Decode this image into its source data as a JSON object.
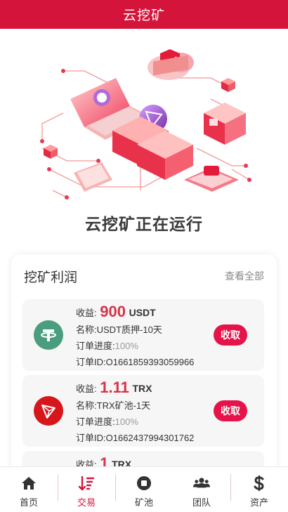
{
  "header": {
    "title": "云挖矿"
  },
  "hero": {
    "status_text": "云挖矿正在运行"
  },
  "profit": {
    "title": "挖矿利润",
    "view_all": "查看全部",
    "labels": {
      "earn": "收益:",
      "name": "名称:",
      "progress": "订单进度:",
      "order_id": "订单ID:",
      "collect": "收取"
    },
    "orders": [
      {
        "coin_icon": "usdt-icon",
        "amount": "900",
        "unit": "USDT",
        "name": "USDT质押-10天",
        "progress": "100%",
        "order_id": "O1661859393059966"
      },
      {
        "coin_icon": "trx-icon",
        "amount": "1.11",
        "unit": "TRX",
        "name": "TRX矿池-1天",
        "progress": "100%",
        "order_id": "O1662437994301762"
      },
      {
        "coin_icon": "trx-icon",
        "amount": "1",
        "unit": "TRX"
      }
    ]
  },
  "nav": {
    "items": [
      {
        "label": "首页",
        "icon": "home-icon"
      },
      {
        "label": "交易",
        "icon": "sort-icon",
        "active": true
      },
      {
        "label": "矿池",
        "icon": "stop-circle-icon"
      },
      {
        "label": "团队",
        "icon": "users-icon"
      },
      {
        "label": "资产",
        "icon": "dollar-icon"
      }
    ]
  },
  "colors": {
    "brand": "#d5143b",
    "button": "#e5134a",
    "amount": "#d6334a",
    "usdt": "#4a9d7f",
    "trx": "#d6161a"
  }
}
